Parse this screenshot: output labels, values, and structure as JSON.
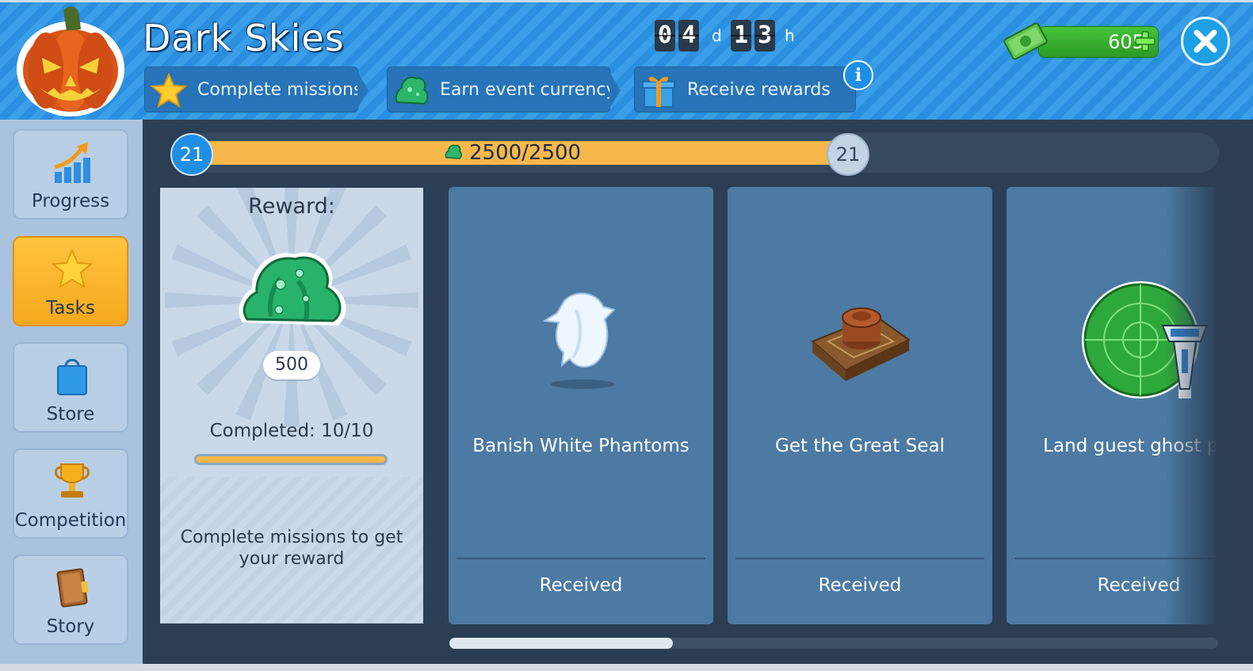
{
  "event": {
    "title": "Dark Skies",
    "steps": [
      {
        "label": "Complete missions",
        "icon": "star-icon"
      },
      {
        "label": "Earn event currency",
        "icon": "slime-icon"
      },
      {
        "label": "Receive rewards",
        "icon": "gift-icon"
      }
    ],
    "timer": {
      "d1": "0",
      "d2": "4",
      "unit_days": "d",
      "h1": "1",
      "h2": "3",
      "unit_hours": "h"
    },
    "currency": {
      "value": "605",
      "icon": "cash-icon"
    }
  },
  "sidebar": {
    "items": [
      {
        "label": "Progress",
        "icon": "growth-arrow-icon",
        "active": false
      },
      {
        "label": "Tasks",
        "icon": "star-icon",
        "active": true
      },
      {
        "label": "Store",
        "icon": "shopping-bag-icon",
        "active": false
      },
      {
        "label": "Competition",
        "icon": "trophy-icon",
        "active": false
      },
      {
        "label": "Story",
        "icon": "book-icon",
        "active": false
      }
    ]
  },
  "progress": {
    "level_start": "21",
    "level_end": "21",
    "label": "2500/2500",
    "fraction": 1.0
  },
  "reward": {
    "title": "Reward:",
    "amount": "500",
    "completed": "Completed: 10/10",
    "completed_fraction": 1.0,
    "description": "Complete missions to get your reward"
  },
  "missions": [
    {
      "name": "Banish White Phantoms",
      "status": "Received",
      "icon": "ghost-icon"
    },
    {
      "name": "Get the Great Seal",
      "status": "Received",
      "icon": "seal-icon"
    },
    {
      "name": "Land guest ghost pla",
      "status": "Received",
      "icon": "radar-tower-icon"
    }
  ],
  "colors": {
    "header_blue": "#2b8fe0",
    "accent_orange": "#f6b84b",
    "active_tab": "#ffc43f",
    "card_blue": "#4c7aa3",
    "money_green": "#3bb330"
  }
}
